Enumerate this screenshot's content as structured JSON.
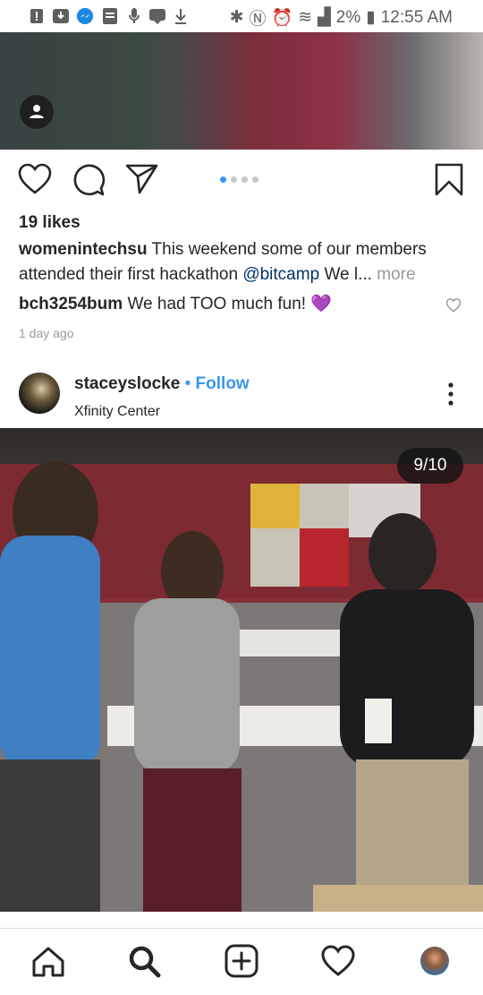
{
  "status_bar": {
    "battery": "2%",
    "time": "12:55 AM"
  },
  "post1": {
    "likes": "19 likes",
    "caption_user": "womenintechsu",
    "caption_text_1": "This weekend some of our members",
    "caption_text_2a": "attended their first hackathon",
    "caption_mention": "@bitcamp",
    "caption_text_2b": "We l...",
    "caption_more": "more",
    "comment_user": "bch3254bum",
    "comment_text": "We had TOO much fun! 💜",
    "time_ago": "1 day ago"
  },
  "post2": {
    "username": "staceyslocke",
    "separator": "•",
    "follow_label": "Follow",
    "location": "Xfinity Center",
    "counter": "9/10"
  },
  "colors": {
    "accent": "#3897f0",
    "text": "#262626",
    "muted": "#999999"
  }
}
